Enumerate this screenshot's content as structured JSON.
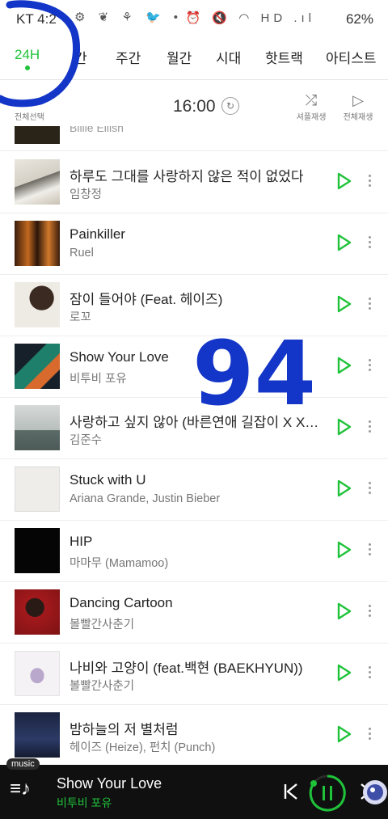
{
  "status": {
    "carrier_time": "KT 4:2",
    "left_icons": "⚙ ❦ ⚘ 🐦 •",
    "right_icons": "⏰ 🔇 ◠ HD .ıl",
    "battery": "62%"
  },
  "tabs": [
    {
      "label": "24H",
      "active": true
    },
    {
      "label": "간",
      "active": false
    },
    {
      "label": "주간",
      "active": false
    },
    {
      "label": "월간",
      "active": false
    },
    {
      "label": "시대",
      "active": false
    },
    {
      "label": "핫트랙",
      "active": false
    },
    {
      "label": "아티스트",
      "active": false
    }
  ],
  "toolbar": {
    "select_all": "전체선택",
    "time": "16:00",
    "shuffle_label": "셔플재생",
    "play_all_label": "전체재생"
  },
  "partial_row": {
    "artist_cut": "Billie Eilish"
  },
  "songs": [
    {
      "title": "하루도 그대를 사랑하지 않은 적이 없었다",
      "artist": "임창정"
    },
    {
      "title": "Painkiller",
      "artist": "Ruel"
    },
    {
      "title": "잠이 들어야 (Feat. 헤이즈)",
      "artist": "로꼬"
    },
    {
      "title": "Show Your Love",
      "artist": "비투비 포유"
    },
    {
      "title": "사랑하고 싶지 않아 (바른연애 길잡이 X XI...",
      "artist": "김준수"
    },
    {
      "title": "Stuck with U",
      "artist": "Ariana Grande, Justin Bieber"
    },
    {
      "title": "HIP",
      "artist": "마마무 (Mamamoo)"
    },
    {
      "title": "Dancing Cartoon",
      "artist": "볼빨간사춘기"
    },
    {
      "title": "나비와 고양이 (feat.백현 (BAEKHYUN))",
      "artist": "볼빨간사춘기"
    },
    {
      "title": "밤하늘의 저 별처럼",
      "artist": "헤이즈 (Heize), 펀치 (Punch)"
    }
  ],
  "player": {
    "tag": "music",
    "title": "Show Your Love",
    "artist": "비투비 포유"
  },
  "annotation": {
    "text": "94",
    "color": "#1436c8"
  },
  "colors": {
    "accent": "#1fc33a",
    "player_bg": "#101010"
  }
}
